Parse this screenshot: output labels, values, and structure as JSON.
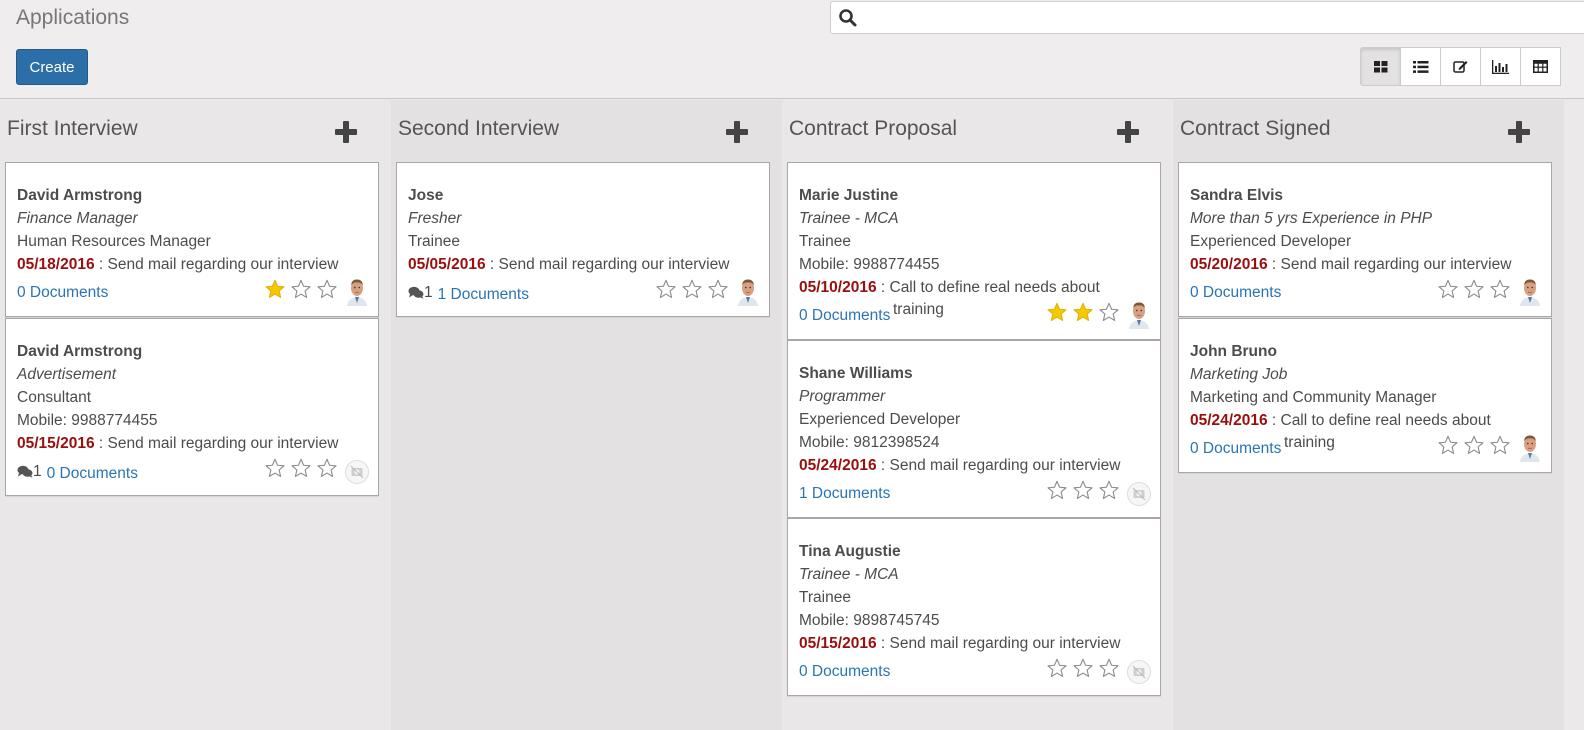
{
  "header": {
    "title": "Applications",
    "create_label": "Create",
    "search": {
      "value": "",
      "placeholder": ""
    },
    "views": [
      {
        "name": "kanban",
        "icon": "kanban-icon",
        "active": true
      },
      {
        "name": "list",
        "icon": "list-icon",
        "active": false
      },
      {
        "name": "form",
        "icon": "edit-icon",
        "active": false
      },
      {
        "name": "graph",
        "icon": "bar-chart-icon",
        "active": false
      },
      {
        "name": "pivot",
        "icon": "table-icon",
        "active": false
      }
    ]
  },
  "colors": {
    "primary": "#2c6ea8",
    "date": "#9b0e0e",
    "link": "#2a74b5",
    "star_on": "#f5c800"
  },
  "columns": [
    {
      "title": "First Interview",
      "cards": [
        {
          "name": "David Armstrong",
          "subject": "Finance Manager",
          "job": "Human Resources Manager",
          "mobile": "",
          "date": "05/18/2016",
          "activity": " : Send mail regarding our interview",
          "activity_overflow": "",
          "comments": "",
          "documents": "0 Documents",
          "rating": 1,
          "avatar": "photo"
        },
        {
          "name": "David Armstrong",
          "subject": "Advertisement",
          "job": "Consultant",
          "mobile": "Mobile: 9988774455",
          "date": "05/15/2016",
          "activity": " : Send mail regarding our interview",
          "activity_overflow": "",
          "comments": "1",
          "documents": "0 Documents",
          "rating": 0,
          "avatar": "placeholder"
        }
      ]
    },
    {
      "title": "Second Interview",
      "cards": [
        {
          "name": "Jose",
          "subject": "Fresher",
          "job": "Trainee",
          "mobile": "",
          "date": "05/05/2016",
          "activity": " : Send mail regarding our interview",
          "activity_overflow": "",
          "comments": "1",
          "documents": "1 Documents",
          "rating": 0,
          "avatar": "photo"
        }
      ]
    },
    {
      "title": "Contract Proposal",
      "cards": [
        {
          "name": "Marie Justine",
          "subject": "Trainee - MCA",
          "job": "Trainee",
          "mobile": "Mobile: 9988774455",
          "date": "05/10/2016",
          "activity": " : Call to define real needs about",
          "activity_overflow": "training",
          "comments": "",
          "documents": "0 Documents",
          "rating": 2,
          "avatar": "photo"
        },
        {
          "name": "Shane Williams",
          "subject": "Programmer",
          "job": "Experienced Developer",
          "mobile": "Mobile: 9812398524",
          "date": "05/24/2016",
          "activity": " : Send mail regarding our interview",
          "activity_overflow": "",
          "comments": "",
          "documents": "1 Documents",
          "rating": 0,
          "avatar": "placeholder"
        },
        {
          "name": "Tina Augustie",
          "subject": "Trainee - MCA",
          "job": "Trainee",
          "mobile": "Mobile: 9898745745",
          "date": "05/15/2016",
          "activity": " : Send mail regarding our interview",
          "activity_overflow": "",
          "comments": "",
          "documents": "0 Documents",
          "rating": 0,
          "avatar": "placeholder"
        }
      ]
    },
    {
      "title": "Contract Signed",
      "cards": [
        {
          "name": "Sandra Elvis",
          "subject": "More than 5 yrs Experience in PHP",
          "job": "Experienced Developer",
          "mobile": "",
          "date": "05/20/2016",
          "activity": " : Send mail regarding our interview",
          "activity_overflow": "",
          "comments": "",
          "documents": "0 Documents",
          "rating": 0,
          "avatar": "photo"
        },
        {
          "name": "John Bruno",
          "subject": "Marketing Job",
          "job": "Marketing and Community Manager",
          "mobile": "",
          "date": "05/24/2016",
          "activity": " : Call to define real needs about",
          "activity_overflow": "training",
          "comments": "",
          "documents": "0 Documents",
          "rating": 0,
          "avatar": "photo"
        }
      ]
    }
  ]
}
